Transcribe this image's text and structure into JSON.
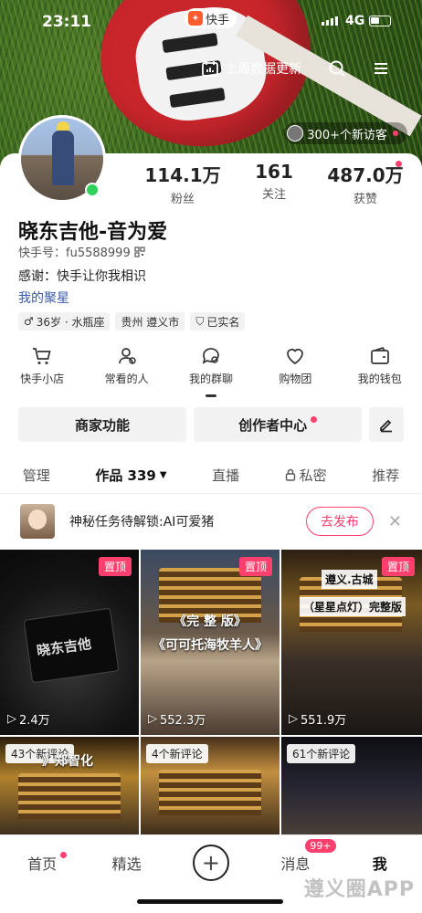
{
  "status_bar": {
    "time": "23:11",
    "app_badge": "快手",
    "network": "4G"
  },
  "header": {
    "update_label": "上周数据更新",
    "visitors_label": "300+个新访客"
  },
  "stats": [
    {
      "value": "114.1万",
      "label": "粉丝"
    },
    {
      "value": "161",
      "label": "关注"
    },
    {
      "value": "487.0万",
      "label": "获赞"
    }
  ],
  "profile": {
    "name": "晓东吉他-音为爱",
    "ks_id": "快手号：fu5588999",
    "bio": "感谢：快手让你我相识",
    "star_link": "我的聚星",
    "tags": [
      "36岁 · 水瓶座",
      "贵州 遵义市",
      "已实名"
    ]
  },
  "shortcuts": [
    {
      "label": "快手小店",
      "icon": "cart-icon"
    },
    {
      "label": "常看的人",
      "icon": "people-icon"
    },
    {
      "label": "我的群聊",
      "icon": "chat-icon"
    },
    {
      "label": "购物团",
      "icon": "heart-icon"
    },
    {
      "label": "我的钱包",
      "icon": "wallet-icon"
    }
  ],
  "buttons": {
    "merchant": "商家功能",
    "creator": "创作者中心"
  },
  "tabs": [
    {
      "label": "管理"
    },
    {
      "label": "作品 339"
    },
    {
      "label": "直播"
    },
    {
      "label": "私密"
    },
    {
      "label": "推荐"
    }
  ],
  "mission": {
    "text": "神秘任务待解锁:AI可爱猪",
    "button": "去发布"
  },
  "videos": [
    {
      "pin": "置顶",
      "views": "2.4万",
      "text": "晓东吉他"
    },
    {
      "pin": "置顶",
      "views": "552.3万",
      "title1": "《完 整 版》",
      "title2": "《可可托海牧羊人》"
    },
    {
      "pin": "置顶",
      "views": "551.9万",
      "title1": "遵义.古城",
      "title2": "（星星点灯）完整版"
    },
    {
      "comments": "43个新评论",
      "extra": "》郑智化"
    },
    {
      "comments": "4个新评论"
    },
    {
      "comments": "61个新评论"
    }
  ],
  "bottom_nav": {
    "home": "首页",
    "featured": "精选",
    "messages": "消息",
    "messages_badge": "99+",
    "me": "我"
  },
  "watermark": "遵义圈APP",
  "colors": {
    "accent": "#ff3f6e",
    "online": "#2fd15a",
    "link": "#3a5aa8"
  }
}
